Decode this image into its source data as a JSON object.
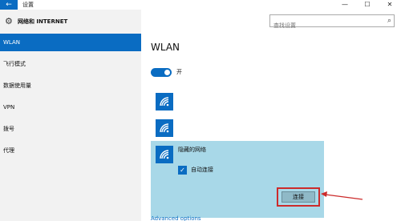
{
  "window": {
    "title": "设置",
    "back_glyph": "←",
    "minimize_glyph": "—",
    "maximize_glyph": "☐",
    "close_glyph": "✕"
  },
  "sidebar": {
    "header_icon": "gear-icon",
    "header_title": "网络和 INTERNET",
    "items": [
      {
        "label": "WLAN",
        "active": true
      },
      {
        "label": "飞行模式",
        "active": false
      },
      {
        "label": "数据使用量",
        "active": false
      },
      {
        "label": "VPN",
        "active": false
      },
      {
        "label": "拨号",
        "active": false
      },
      {
        "label": "代理",
        "active": false
      }
    ]
  },
  "search": {
    "placeholder": "查找设置",
    "icon": "search-icon"
  },
  "main": {
    "title": "WLAN",
    "toggle_label": "开",
    "toggle_on": true,
    "hidden_network": {
      "name": "隐藏的网络",
      "auto_connect_label": "自动连接",
      "auto_connect_checked": true,
      "connect_label": "连接"
    },
    "advanced_link": "Advanced options"
  },
  "colors": {
    "accent": "#0a6cc2",
    "selected_panel": "#a8d8e8",
    "highlight_border": "#cc2b2b"
  }
}
